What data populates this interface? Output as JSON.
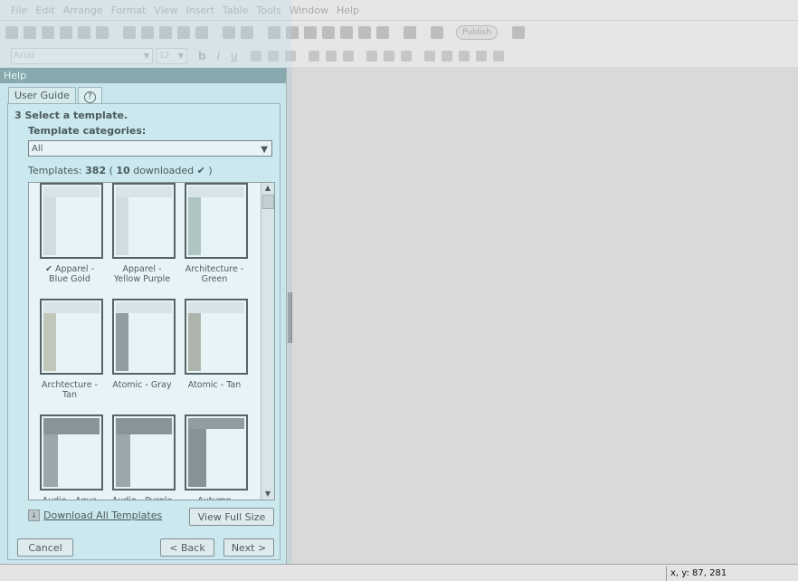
{
  "menu": [
    "File",
    "Edit",
    "Arrange",
    "Format",
    "View",
    "Insert",
    "Table",
    "Tools",
    "Window",
    "Help"
  ],
  "toolbar": {
    "publish_label": "Publish"
  },
  "format_bar": {
    "font": "Arial",
    "size": "12",
    "bold": "b",
    "italic": "i",
    "underline": "u"
  },
  "help_panel": {
    "title": "Help",
    "tabs": [
      "User Guide",
      "?"
    ],
    "step_heading": "3 Select a template.",
    "category_label": "Template categories:",
    "category_value": "All",
    "count_prefix": "Templates:",
    "count_total": "382",
    "count_open": "(",
    "count_downloaded": "10",
    "count_downloaded_label": "downloaded",
    "count_close": ")",
    "download_all_label": "Download All Templates",
    "view_full_size_label": "View Full Size",
    "cancel_label": "Cancel",
    "back_label": "< Back",
    "next_label": "Next >"
  },
  "templates": [
    {
      "name": "Apparel - Blue Gold",
      "downloaded": true,
      "style": "plain"
    },
    {
      "name": "Apparel - Yellow Purple",
      "downloaded": false,
      "style": "plain"
    },
    {
      "name": "Architecture - Green",
      "downloaded": false,
      "style": "green"
    },
    {
      "name": "Archtecture - Tan",
      "downloaded": false,
      "style": "tan"
    },
    {
      "name": "Atomic - Gray",
      "downloaded": false,
      "style": "gray"
    },
    {
      "name": "Atomic - Tan",
      "downloaded": false,
      "style": "tan2"
    },
    {
      "name": "Audio - Aqua",
      "downloaded": false,
      "style": "aqua"
    },
    {
      "name": "Audio - Purple",
      "downloaded": false,
      "style": "aqua"
    },
    {
      "name": "Autumn",
      "downloaded": false,
      "style": "autumn"
    }
  ],
  "status": {
    "coordinates": "x, y: 87, 281"
  }
}
